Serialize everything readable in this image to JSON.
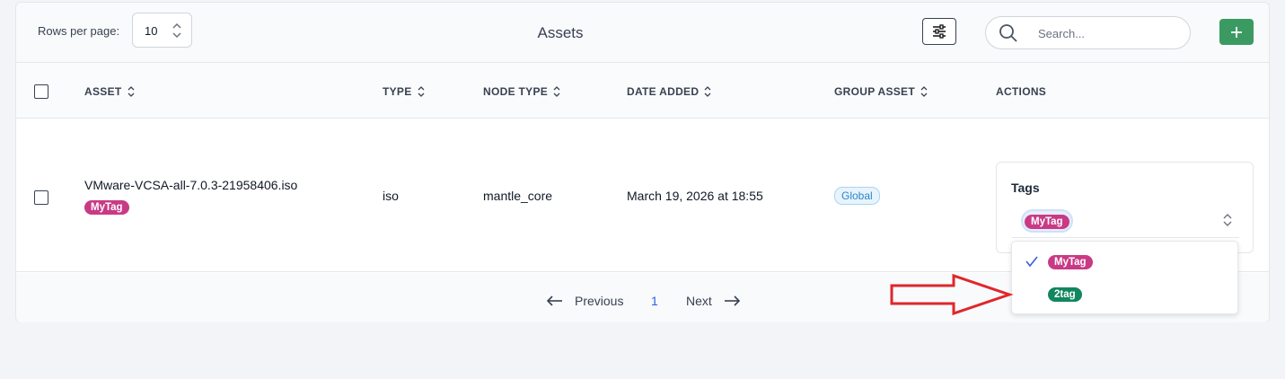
{
  "toolbar": {
    "rows_per_page_label": "Rows per page:",
    "rows_per_page_value": "10",
    "title": "Assets",
    "search_placeholder": "Search...",
    "filter_icon": "sliders-icon",
    "add_icon": "plus-icon",
    "add_color": "#3b9a62"
  },
  "table": {
    "headers": {
      "asset": "ASSET",
      "type": "TYPE",
      "node_type": "NODE TYPE",
      "date_added": "DATE ADDED",
      "group_asset": "GROUP ASSET",
      "actions": "ACTIONS"
    },
    "rows": [
      {
        "asset": "VMware-VCSA-all-7.0.3-21958406.iso",
        "asset_tag": "MyTag",
        "type": "iso",
        "node_type": "mantle_core",
        "date_added": "March 19, 2026 at 18:55",
        "group_asset": "Global"
      }
    ]
  },
  "tags_editor": {
    "label": "Tags",
    "selected_tag": "MyTag",
    "options": [
      {
        "label": "MyTag",
        "selected": true,
        "color": "#c93a86"
      },
      {
        "label": "2tag",
        "selected": false,
        "color": "#12865e"
      }
    ]
  },
  "pagination": {
    "previous": "Previous",
    "current_page": "1",
    "next": "Next"
  },
  "annotation": {
    "arrow_color": "#e0262b"
  }
}
